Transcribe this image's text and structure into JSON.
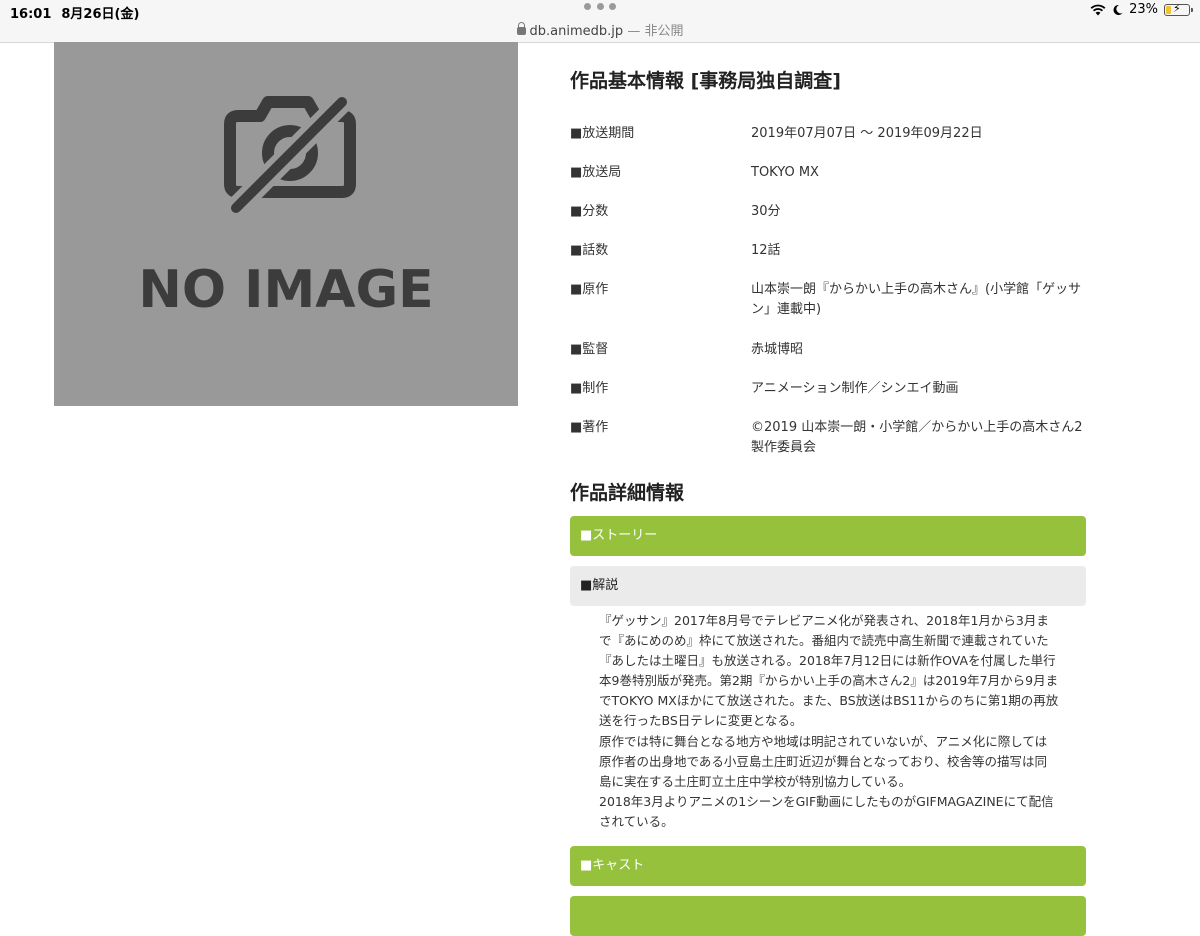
{
  "status_bar": {
    "time": "16:01",
    "date": "8月26日(金)",
    "url": "db.animedb.jp",
    "private_label": "— 非公開",
    "battery": "23%",
    "battery_level": 0.23
  },
  "image_placeholder": {
    "text": "NO IMAGE"
  },
  "basic_info": {
    "title": "作品基本情報 [事務局独自調査]",
    "rows": [
      {
        "label": "■放送期間",
        "value": "2019年07月07日 〜 2019年09月22日"
      },
      {
        "label": "■放送局",
        "value": "TOKYO MX"
      },
      {
        "label": "■分数",
        "value": "30分"
      },
      {
        "label": "■話数",
        "value": "12話"
      },
      {
        "label": "■原作",
        "value": "山本崇一朗『からかい上手の高木さん』(小学館「ゲッサン」連載中)"
      },
      {
        "label": "■監督",
        "value": "赤城博昭"
      },
      {
        "label": "■制作",
        "value": "アニメーション制作／シンエイ動画"
      },
      {
        "label": "■著作",
        "value": "©2019 山本崇一朗・小学館／からかい上手の高木さん2製作委員会"
      }
    ]
  },
  "detail_info": {
    "title": "作品詳細情報",
    "story_label": "■ストーリー",
    "commentary_label": "■解説",
    "commentary_paragraphs": [
      "『ゲッサン』2017年8月号でテレビアニメ化が発表され、2018年1月から3月まで『あにめのめ』枠にて放送された。番組内で読売中高生新聞で連載されていた『あしたは土曜日』も放送される。2018年7月12日には新作OVAを付属した単行本9巻特別版が発売。第2期『からかい上手の高木さん2』は2019年7月から9月までTOKYO MXほかにて放送された。また、BS放送はBS11からのちに第1期の再放送を行ったBS日テレに変更となる。",
      "原作では特に舞台となる地方や地域は明記されていないが、アニメ化に際しては原作者の出身地である小豆島土庄町近辺が舞台となっており、校舎等の描写は同島に実在する土庄町立土庄中学校が特別協力している。",
      "2018年3月よりアニメの1シーンをGIF動画にしたものがGIFMAGAZINEにて配信されている。"
    ],
    "cast_label": "■キャスト"
  },
  "colors": {
    "accent_green": "#95c13d",
    "placeholder_gray": "#999999"
  }
}
